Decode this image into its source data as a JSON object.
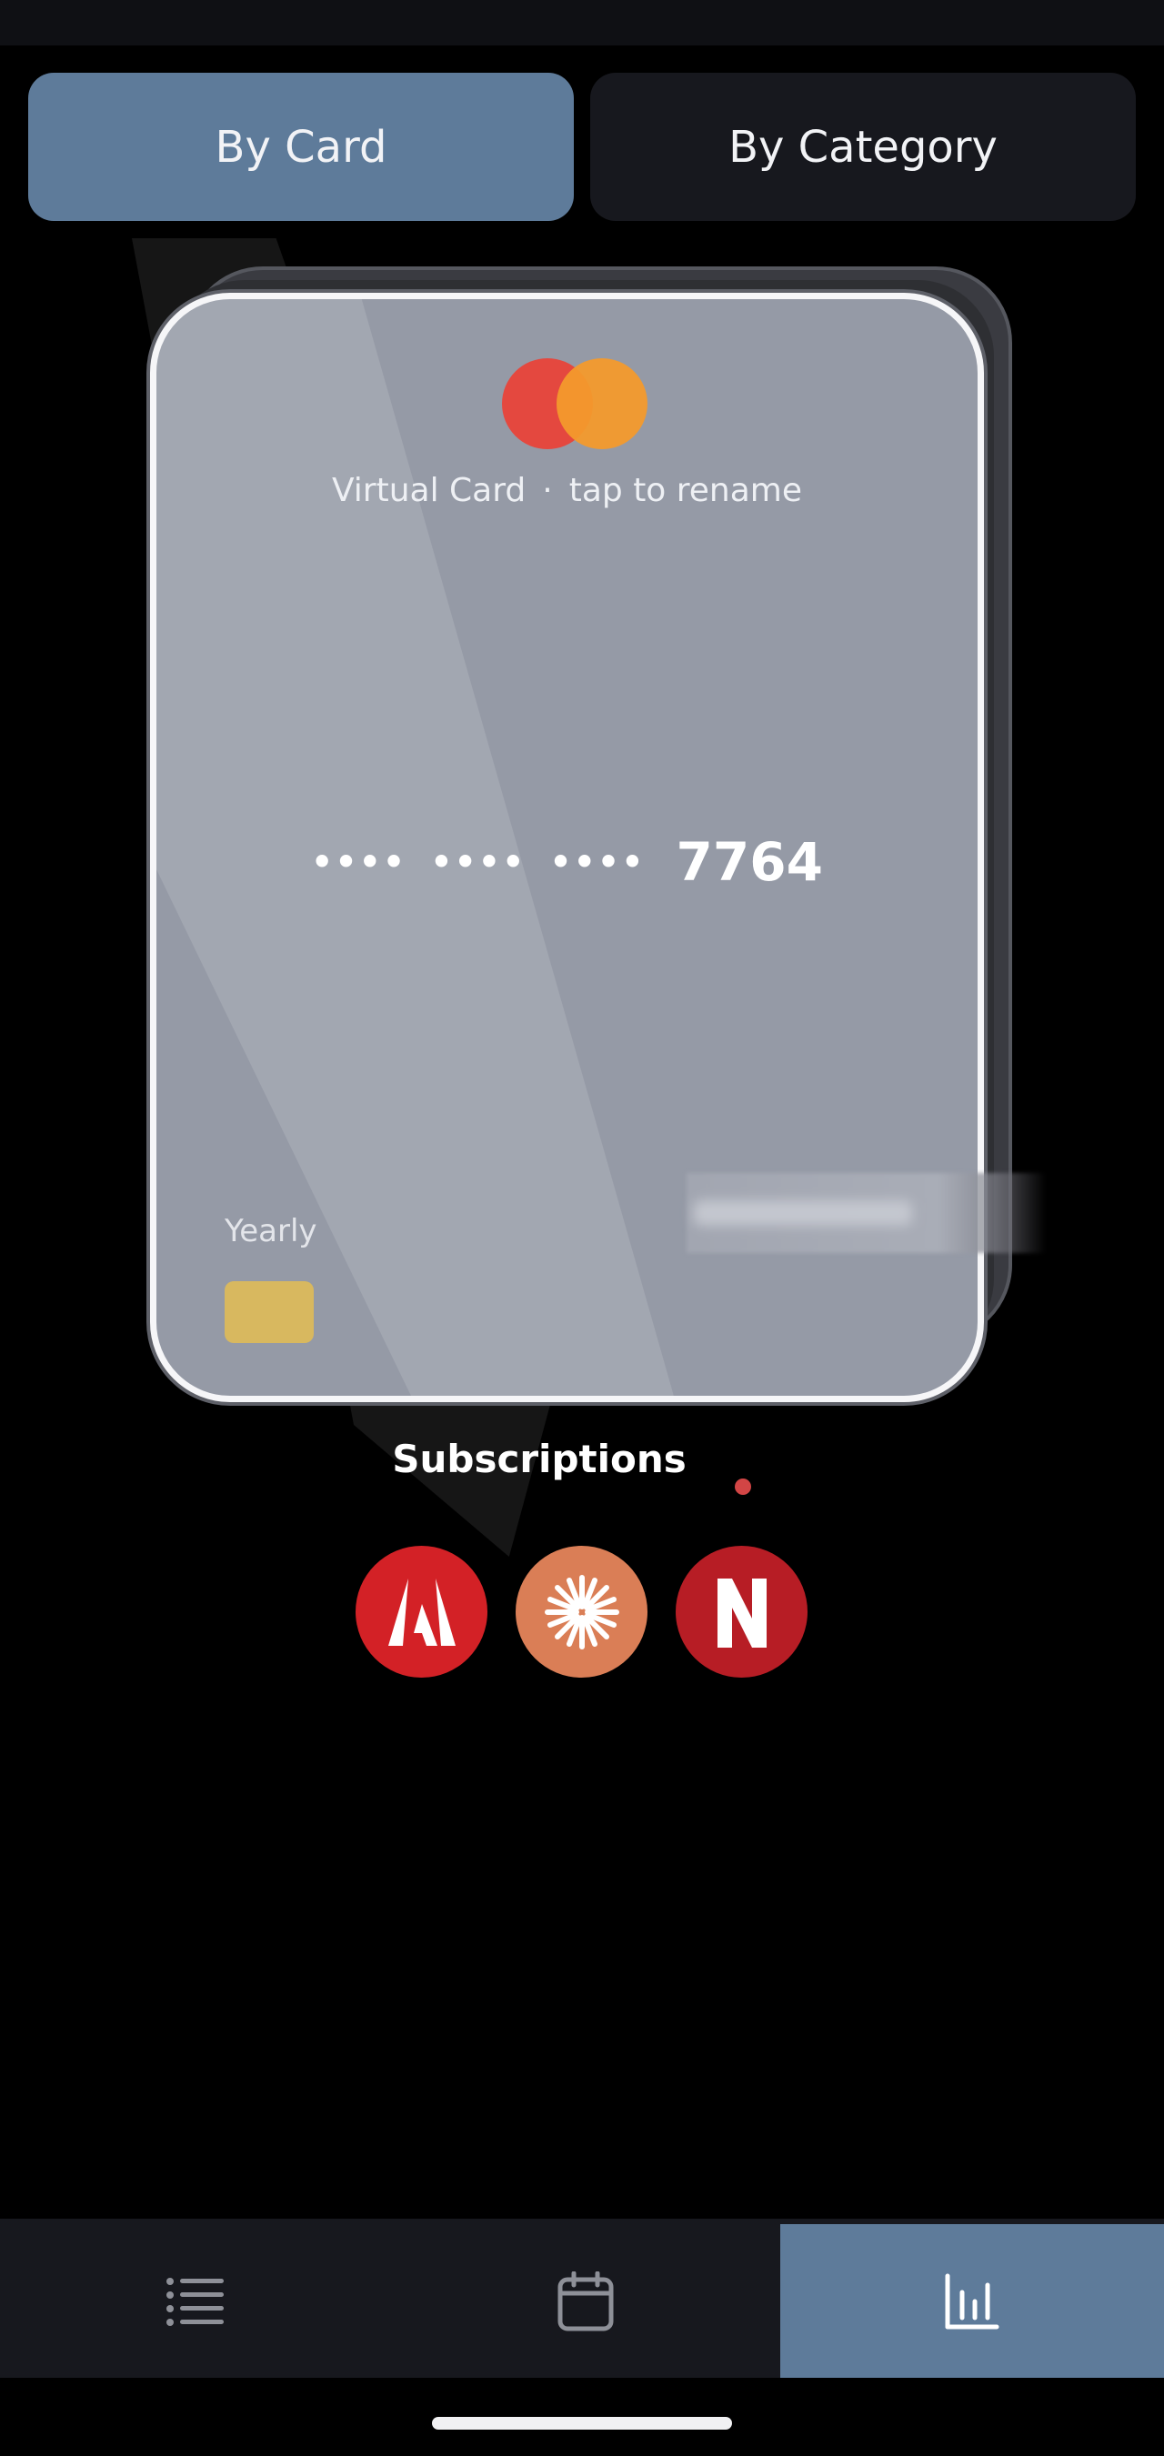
{
  "tabs": {
    "by_card": "By Card",
    "by_category": "By Category"
  },
  "card": {
    "name": "Virtual Card",
    "separator": "·",
    "rename_hint": "tap to rename",
    "masked_groups": [
      "••••",
      "••••",
      "••••"
    ],
    "last4": "7764",
    "billing_cycle": "Yearly",
    "brand_icon": "mastercard-logo-icon"
  },
  "subscriptions": {
    "title": "Subscriptions",
    "items": [
      {
        "name": "adobe-icon",
        "color": "#d32126"
      },
      {
        "name": "claude-icon",
        "color": "#da7e56"
      },
      {
        "name": "netflix-icon",
        "color": "#b71d25"
      }
    ]
  },
  "bottom_nav": {
    "items": [
      "list-icon",
      "calendar-icon",
      "bar-chart-icon"
    ],
    "active": "bar-chart-icon"
  },
  "colors": {
    "accent": "#5e7b9a",
    "surface": "#17181e",
    "card": "#959aa6",
    "chip": "#d8b85f"
  }
}
